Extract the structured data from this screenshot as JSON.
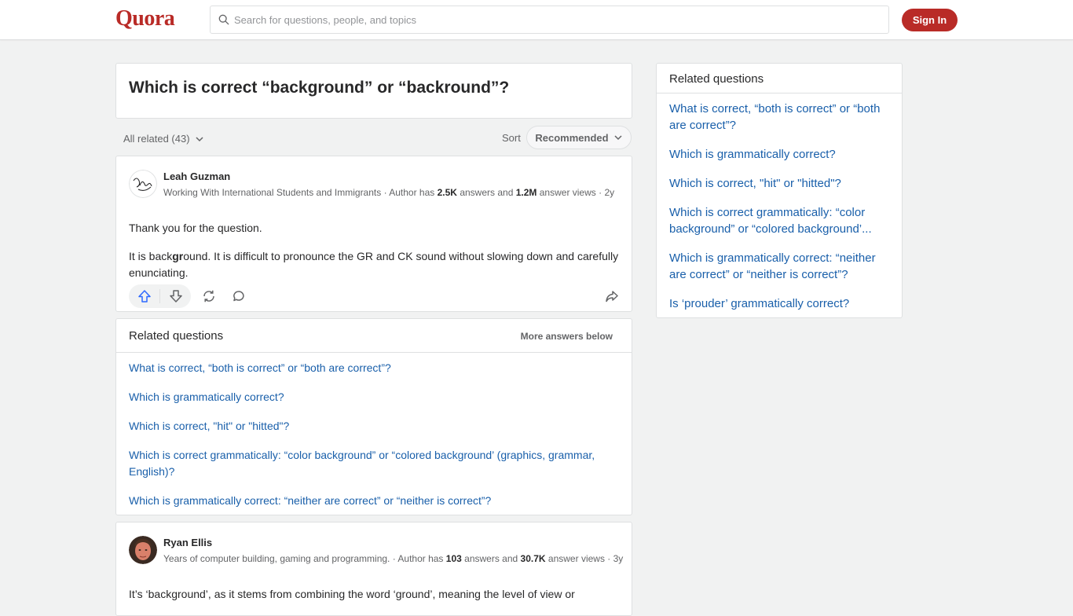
{
  "header": {
    "logo": "Quora",
    "search_placeholder": "Search for questions, people, and topics",
    "signin_label": "Sign In"
  },
  "question": {
    "title": "Which is correct “background” or “backround”?"
  },
  "filters": {
    "all_related": "All related (43)",
    "sort_label": "Sort",
    "sort_value": "Recommended"
  },
  "answers": [
    {
      "author": "Leah Guzman",
      "cred_text": "Working With International Students and Immigrants · Author has",
      "answers_count": "2.5K",
      "answers_word": "answers and",
      "views_count": "1.2M",
      "views_word": "answer views · 2y",
      "paragraph1": "Thank you for the question.",
      "paragraph2_a": "It is back",
      "paragraph2_bold": "gr",
      "paragraph2_b": "ound. It is difficult to pronounce the GR and CK sound without slowing down and carefully enunciating."
    },
    {
      "author": "Ryan Ellis",
      "cred_text": "Years of computer building, gaming and programming. · Author has",
      "answers_count": "103",
      "answers_word": "answers and",
      "views_count": "30.7K",
      "views_word": "answer views · 3y",
      "paragraph1": "It’s ‘background’, as it stems from combining the word ‘ground’, meaning the level of view or"
    }
  ],
  "related_mid": {
    "title": "Related questions",
    "more_below": "More answers below",
    "links": [
      "What is correct, “both is correct” or “both are correct”?",
      "Which is grammatically correct?",
      "Which is correct, \"hit\" or \"hitted\"?",
      "Which is correct grammatically: “color background” or “colored background’ (graphics, grammar, English)?",
      "Which is grammatically correct: “neither are correct” or “neither is correct”?"
    ]
  },
  "related_side": {
    "title": "Related questions",
    "links": [
      "What is correct, “both is correct” or “both are correct”?",
      "Which is grammatically correct?",
      "Which is correct, \"hit\" or \"hitted\"?",
      "Which is correct grammatically: “color background” or “colored background’...",
      "Which is grammatically correct: “neither are correct” or “neither is correct”?",
      "Is ‘prouder’ grammatically correct?"
    ]
  },
  "colors": {
    "brand": "#b92b27",
    "link": "#195faa",
    "text": "#282829",
    "muted": "#636466",
    "background": "#f1f2f2",
    "border": "#dee0e1",
    "upvote": "#2e69ff"
  }
}
